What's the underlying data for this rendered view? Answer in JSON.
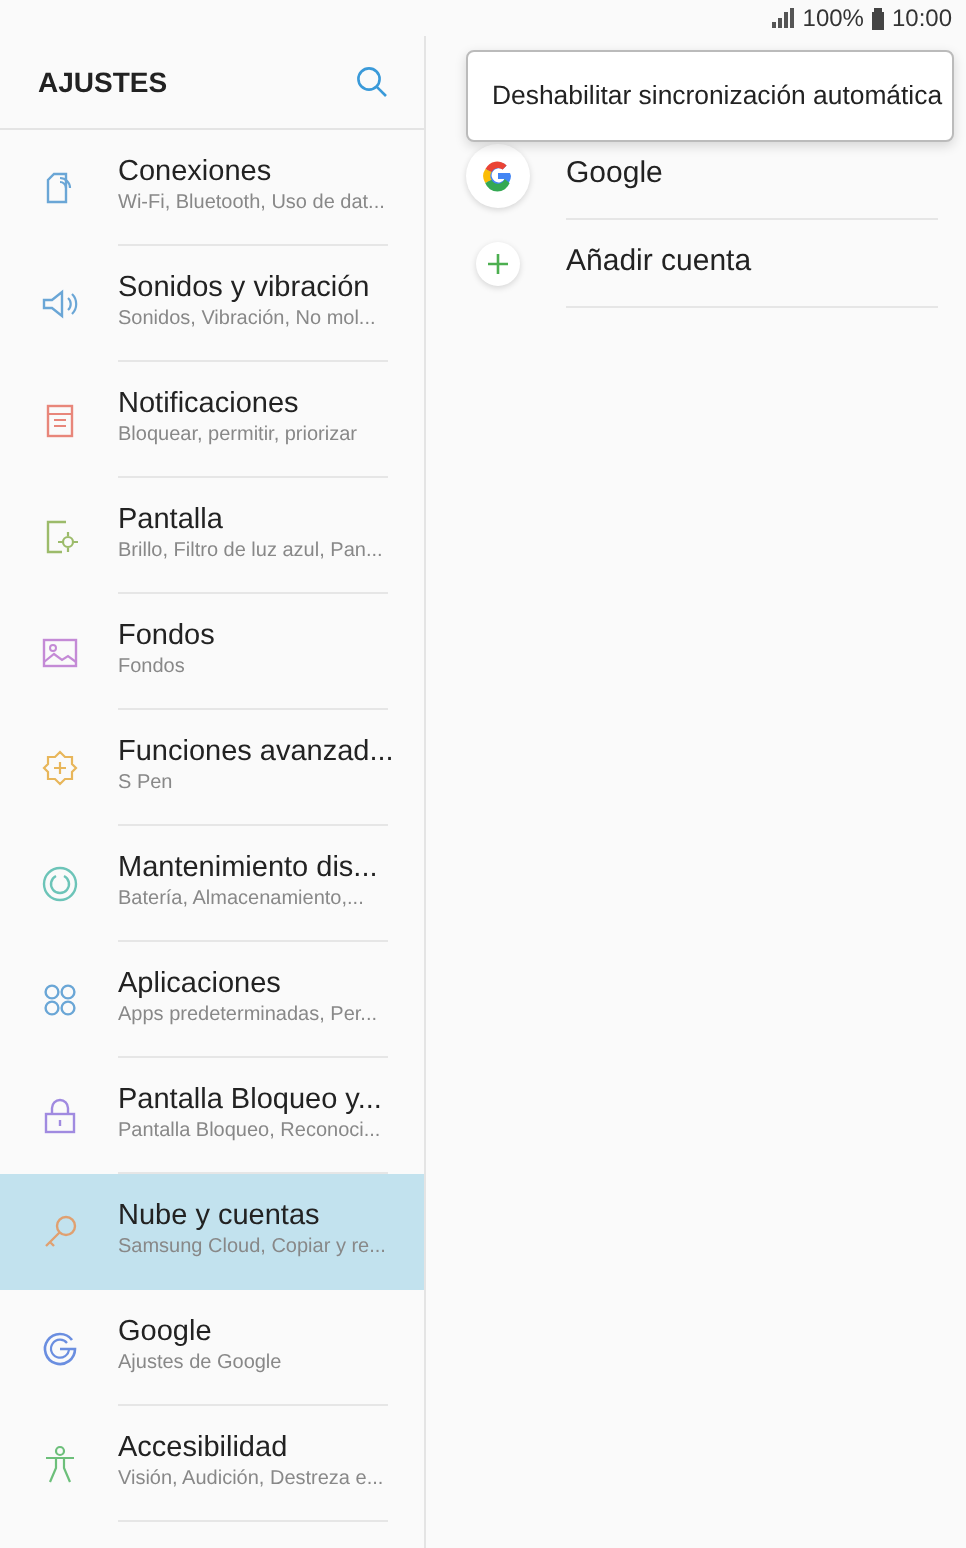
{
  "status_bar": {
    "battery": "100%",
    "time": "10:00"
  },
  "sidebar": {
    "title": "AJUSTES",
    "items": [
      {
        "kind": "connections",
        "color": "#6aa6d6",
        "title": "Conexiones",
        "subtitle": "Wi-Fi, Bluetooth, Uso de dat...",
        "selected": false
      },
      {
        "kind": "sound",
        "color": "#6aa6d6",
        "title": "Sonidos y vibración",
        "subtitle": "Sonidos, Vibración, No mol...",
        "selected": false
      },
      {
        "kind": "notifications",
        "color": "#e8867a",
        "title": "Notificaciones",
        "subtitle": "Bloquear, permitir, priorizar",
        "selected": false
      },
      {
        "kind": "display",
        "color": "#9cbb6a",
        "title": "Pantalla",
        "subtitle": "Brillo, Filtro de luz azul, Pan...",
        "selected": false
      },
      {
        "kind": "wallpaper",
        "color": "#c48ad6",
        "title": "Fondos",
        "subtitle": "Fondos",
        "selected": false
      },
      {
        "kind": "advanced",
        "color": "#e8b65a",
        "title": "Funciones avanzad...",
        "subtitle": "S Pen",
        "selected": false
      },
      {
        "kind": "maintenance",
        "color": "#6cc4b8",
        "title": "Mantenimiento dis...",
        "subtitle": "Batería, Almacenamiento,...",
        "selected": false
      },
      {
        "kind": "apps",
        "color": "#6aa6d6",
        "title": "Aplicaciones",
        "subtitle": "Apps predeterminadas, Per...",
        "selected": false
      },
      {
        "kind": "lock",
        "color": "#a08ae0",
        "title": "Pantalla Bloqueo y...",
        "subtitle": "Pantalla Bloqueo, Reconoci...",
        "selected": false
      },
      {
        "kind": "key",
        "color": "#e0a070",
        "title": "Nube y cuentas",
        "subtitle": "Samsung Cloud, Copiar y re...",
        "selected": true
      },
      {
        "kind": "google",
        "color": "#6a8ee0",
        "title": "Google",
        "subtitle": "Ajustes de Google",
        "selected": false
      },
      {
        "kind": "accessibility",
        "color": "#6cbf7a",
        "title": "Accesibilidad",
        "subtitle": "Visión, Audición, Destreza e...",
        "selected": false
      }
    ]
  },
  "accounts": [
    {
      "kind": "google",
      "label": "Google"
    },
    {
      "kind": "add",
      "label": "Añadir cuenta"
    }
  ],
  "popup_menu": {
    "items": [
      "Deshabilitar sincronización automática"
    ]
  }
}
